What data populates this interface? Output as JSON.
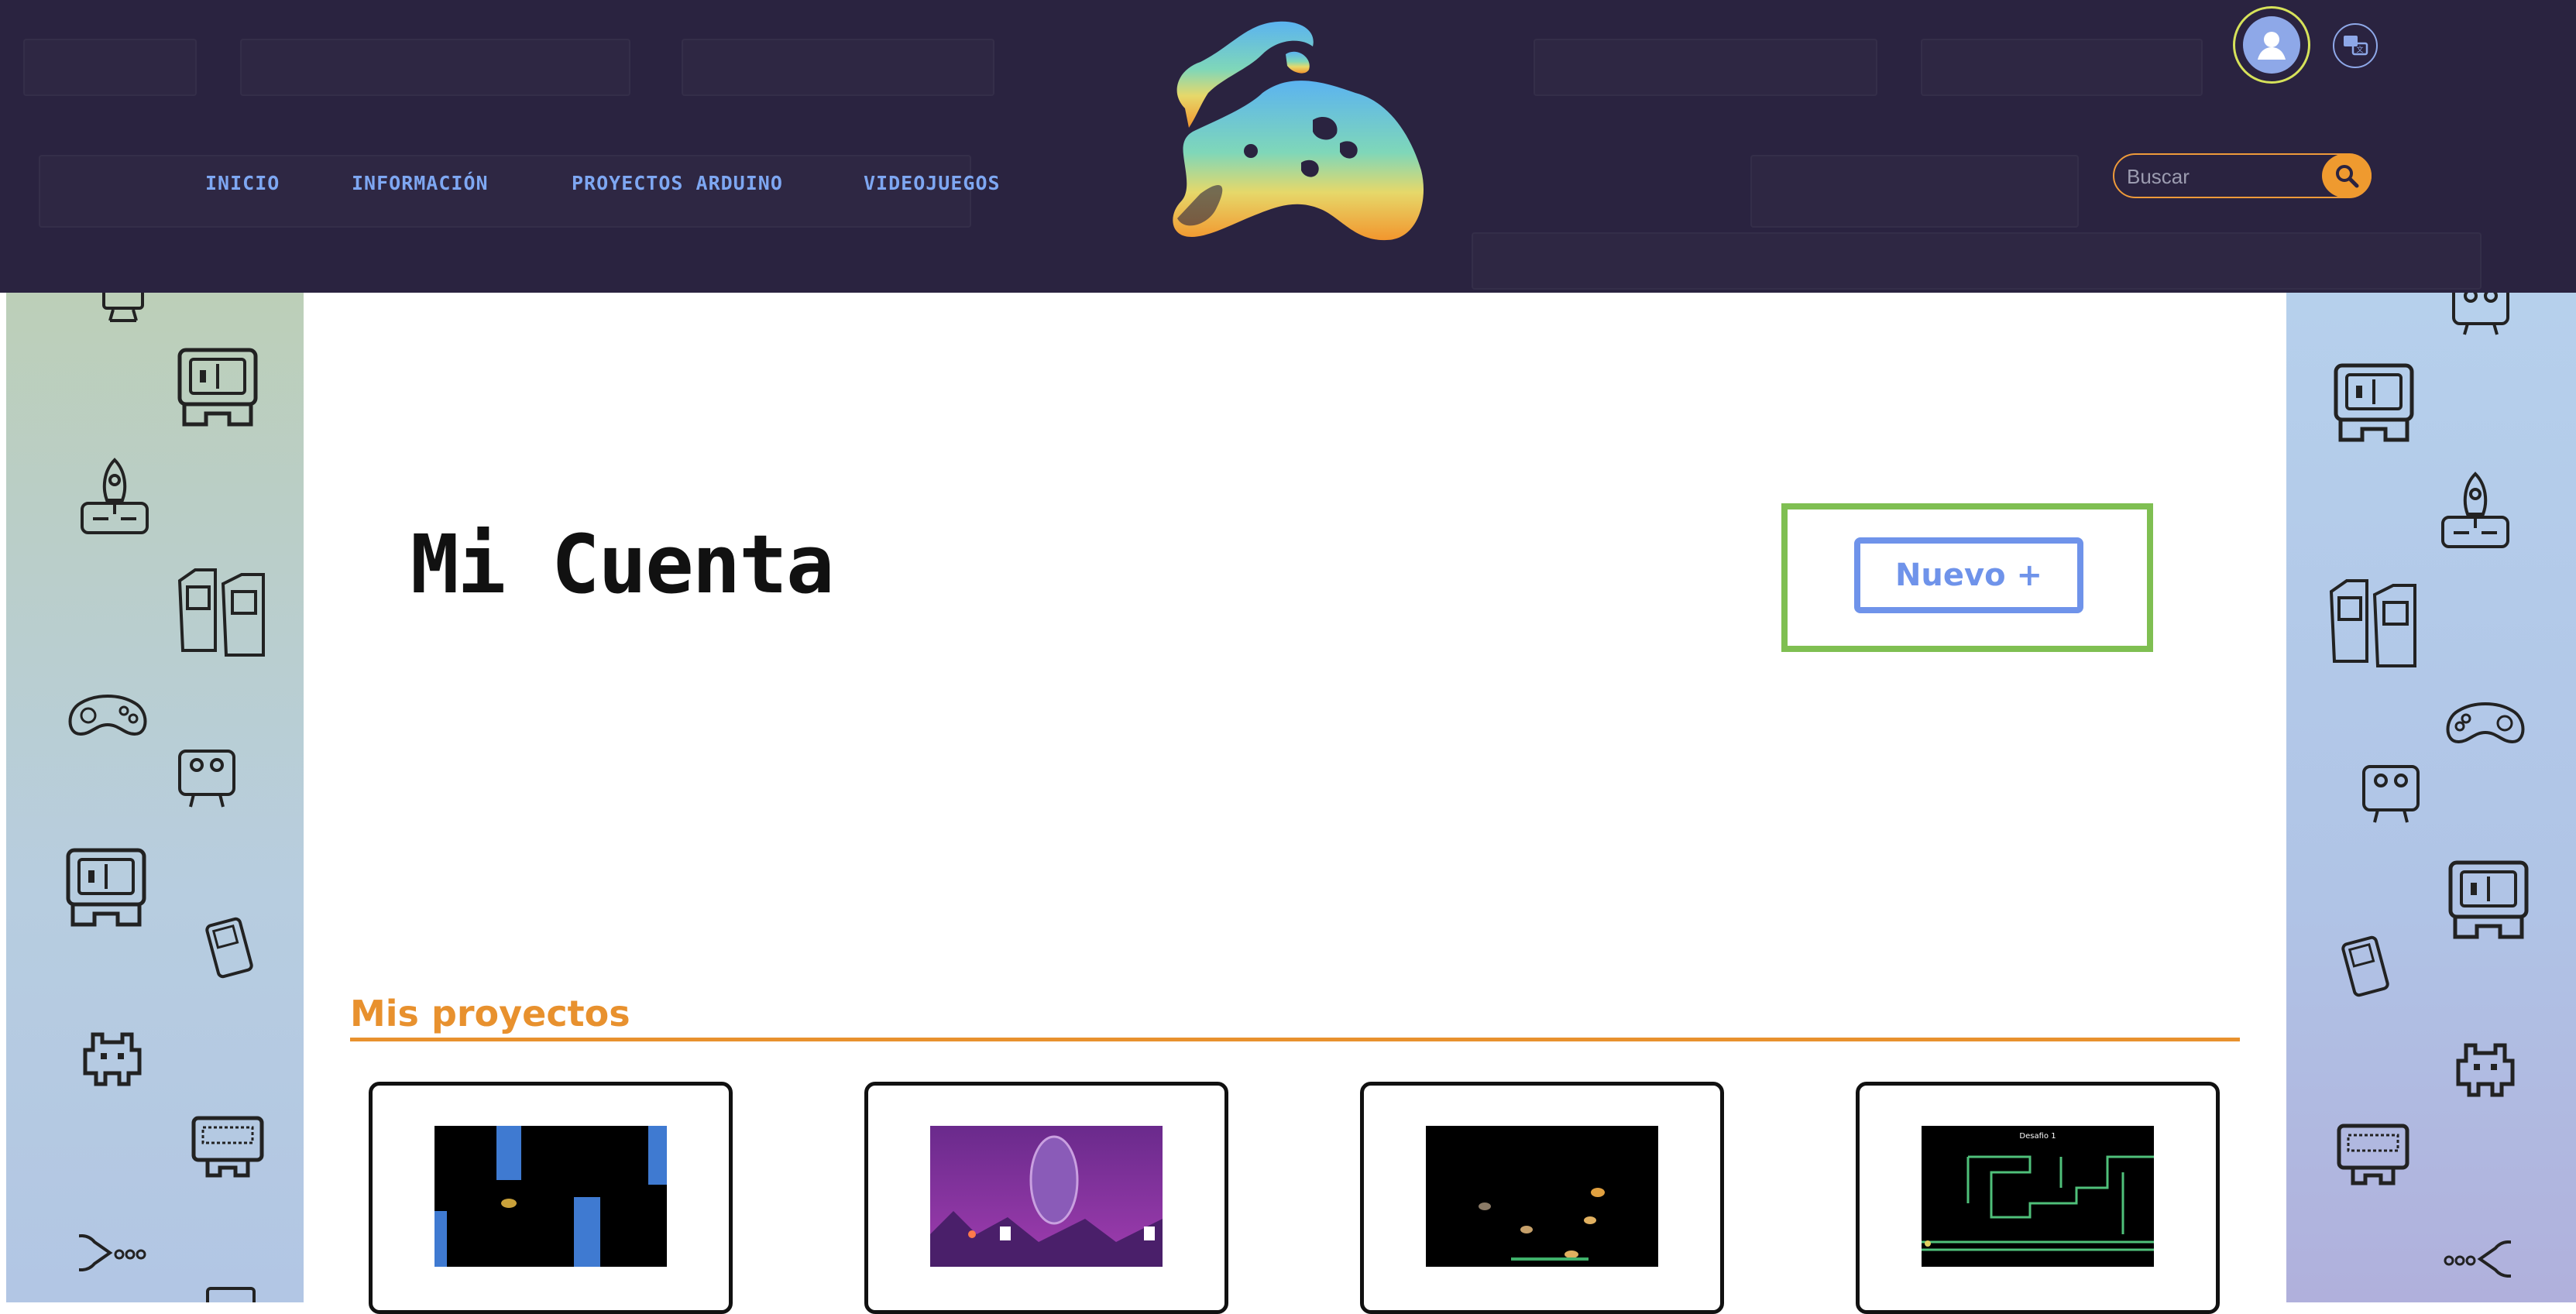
{
  "header": {
    "nav": [
      {
        "label": "INICIO"
      },
      {
        "label": "INFORMACIÓN"
      },
      {
        "label": "PROYECTOS ARDUINO"
      },
      {
        "label": "VIDEOJUEGOS"
      }
    ],
    "search": {
      "placeholder": "Buscar"
    }
  },
  "main": {
    "title": "Mi Cuenta",
    "new_button": "Nuevo +",
    "projects_heading": "Mis proyectos",
    "projects": [
      {
        "thumb": "flappy-game-thumbnail"
      },
      {
        "thumb": "space-purple-game-thumbnail"
      },
      {
        "thumb": "bounce-game-thumbnail"
      },
      {
        "thumb": "maze-game-thumbnail",
        "caption": "Desafio 1"
      }
    ]
  },
  "colors": {
    "header_bg": "#2a2340",
    "nav_text": "#7ea7f2",
    "accent_orange": "#e8912e",
    "highlight_green": "#7fbf52",
    "button_blue": "#6f93ea"
  }
}
